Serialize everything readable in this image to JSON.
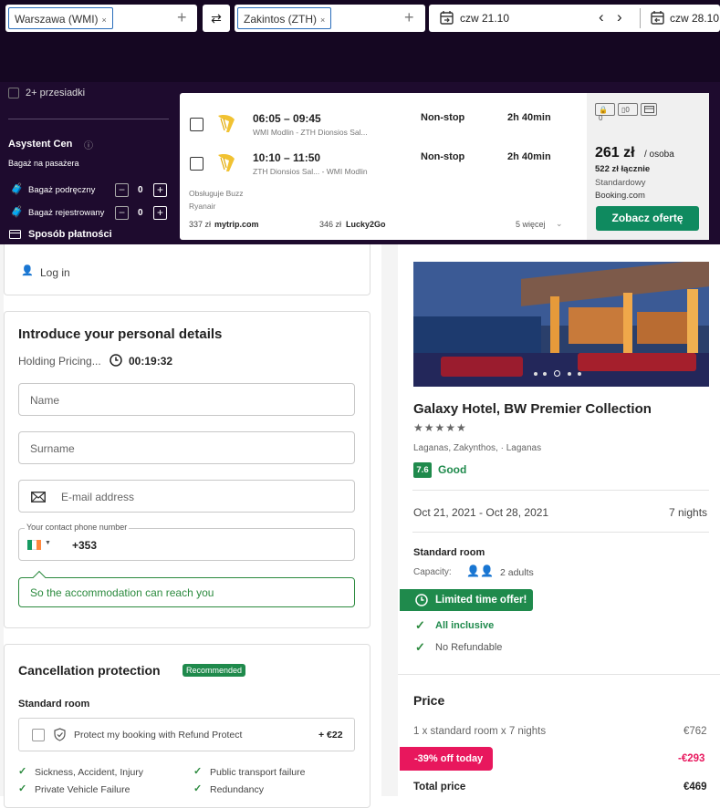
{
  "search": {
    "origin": "Warszawa (WMI)",
    "destination": "Zakintos (ZTH)",
    "depart_date": "czw 21.10",
    "return_date": "czw 28.10",
    "remove": "×",
    "add": "+",
    "swap": "⇄",
    "prev": "‹",
    "next": "›"
  },
  "filters": {
    "stops_label": "2+ przesiadki",
    "assistant_title": "Asystent Cen",
    "baggage_title": "Bagaż na pasażera",
    "carry_on_label": "Bagaż podręczny",
    "carry_on_value": "0",
    "checked_label": "Bagaż rejestrowany",
    "checked_value": "0",
    "payment_label": "Sposób płatności",
    "minus": "−",
    "plus": "+"
  },
  "flight": {
    "legs": [
      {
        "times": "06:05 – 09:45",
        "route": "WMI Modlin - ZTH Dionsios Sal...",
        "stops": "Non-stop",
        "duration": "2h 40min"
      },
      {
        "times": "10:10 – 11:50",
        "route": "ZTH Dionsios Sal... - WMI Modlin",
        "stops": "Non-stop",
        "duration": "2h 40min"
      }
    ],
    "operated_by": "Obsługuje Buzz",
    "airline": "Ryanair",
    "alt_price_1": "337 zł",
    "alt_provider_1": "mytrip.com",
    "alt_price_2": "346 zł",
    "alt_provider_2": "Lucky2Go",
    "more": "5 więcej",
    "bag_count_1": "0",
    "bag_count_2": "0",
    "price": "261 zł",
    "per_person": "/ osoba",
    "total": "522 zł łącznie",
    "fare_type": "Standardowy",
    "provider": "Booking.com",
    "cta": "Zobacz ofertę"
  },
  "booking": {
    "login": "Log in",
    "title": "Introduce your personal details",
    "holding": "Holding Pricing...",
    "timer": "00:19:32",
    "name_placeholder": "Name",
    "surname_placeholder": "Surname",
    "email_placeholder": "E-mail address",
    "phone_label": "Your contact phone number",
    "phone_prefix": "+353",
    "hint": "So the accommodation can reach you",
    "cancel_title": "Cancellation protection",
    "recommended": "Recommended",
    "room_type": "Standard room",
    "protect_label": "Protect my booking with Refund Protect",
    "protect_price": "+ €22",
    "coverage": [
      "Sickness, Accident, Injury",
      "Public transport failure",
      "Private Vehicle Failure",
      "Redundancy"
    ]
  },
  "hotel": {
    "name": "Galaxy Hotel, BW Premier Collection",
    "stars": "★★★★★",
    "location": "Laganas, Zakynthos, · Laganas",
    "score": "7.6",
    "score_label": "Good",
    "dates": "Oct 21, 2021 - Oct 28, 2021",
    "nights": "7 nights",
    "room": "Standard room",
    "capacity_label": "Capacity:",
    "capacity_value": "2 adults",
    "offer": "Limited time offer!",
    "features": [
      "All inclusive",
      "No Refundable"
    ],
    "price_title": "Price",
    "line_item": "1 x standard room x 7 nights",
    "line_price": "€762",
    "discount_label": "-39% off today",
    "discount_value": "-€293",
    "total_label": "Total price",
    "total_value": "€469"
  },
  "colors": {
    "brand_dark": "#1e0b2e",
    "green": "#0f8a5f",
    "hint_green": "#2b8a3e",
    "pink": "#e8175d"
  }
}
